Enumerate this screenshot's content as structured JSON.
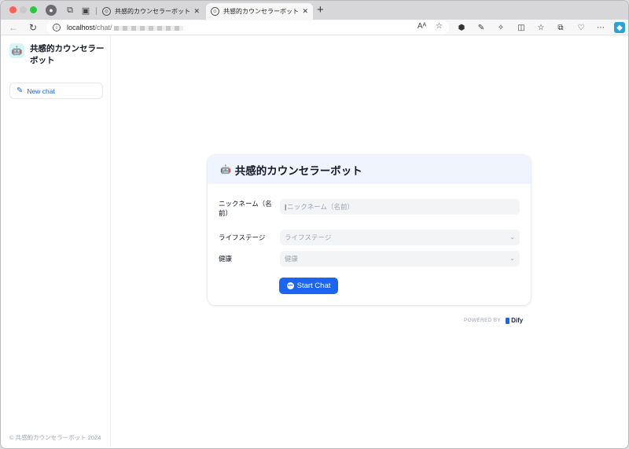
{
  "browser": {
    "tabs": [
      {
        "title": "共感的カウンセラーボット - Dify",
        "active": false
      },
      {
        "title": "共感的カウンセラーボット - Powe",
        "active": true
      }
    ],
    "new_tab_symbol": "+",
    "address": {
      "host": "localhost",
      "path": "/chat/"
    },
    "read_aloud_label": "Aᴬ"
  },
  "sidebar": {
    "app_name": "共感的カウンセラーボット",
    "app_icon": "🤖",
    "new_chat_label": "New chat",
    "footer": "© 共感的カウンセラーボット 2024"
  },
  "card": {
    "icon": "🤖",
    "title": "共感的カウンセラーボット",
    "fields": [
      {
        "label": "ニックネーム（名前）",
        "placeholder": "ニックネーム（名前）",
        "type": "text"
      },
      {
        "label": "ライフステージ",
        "placeholder": "ライフステージ",
        "type": "select"
      },
      {
        "label": "健康",
        "placeholder": "健康",
        "type": "select"
      }
    ],
    "start_label": "Start Chat"
  },
  "powered_by": {
    "label": "POWERED BY",
    "brand": "Dify"
  },
  "colors": {
    "accent": "#1c64f2",
    "card_header": "#eff4fd"
  }
}
